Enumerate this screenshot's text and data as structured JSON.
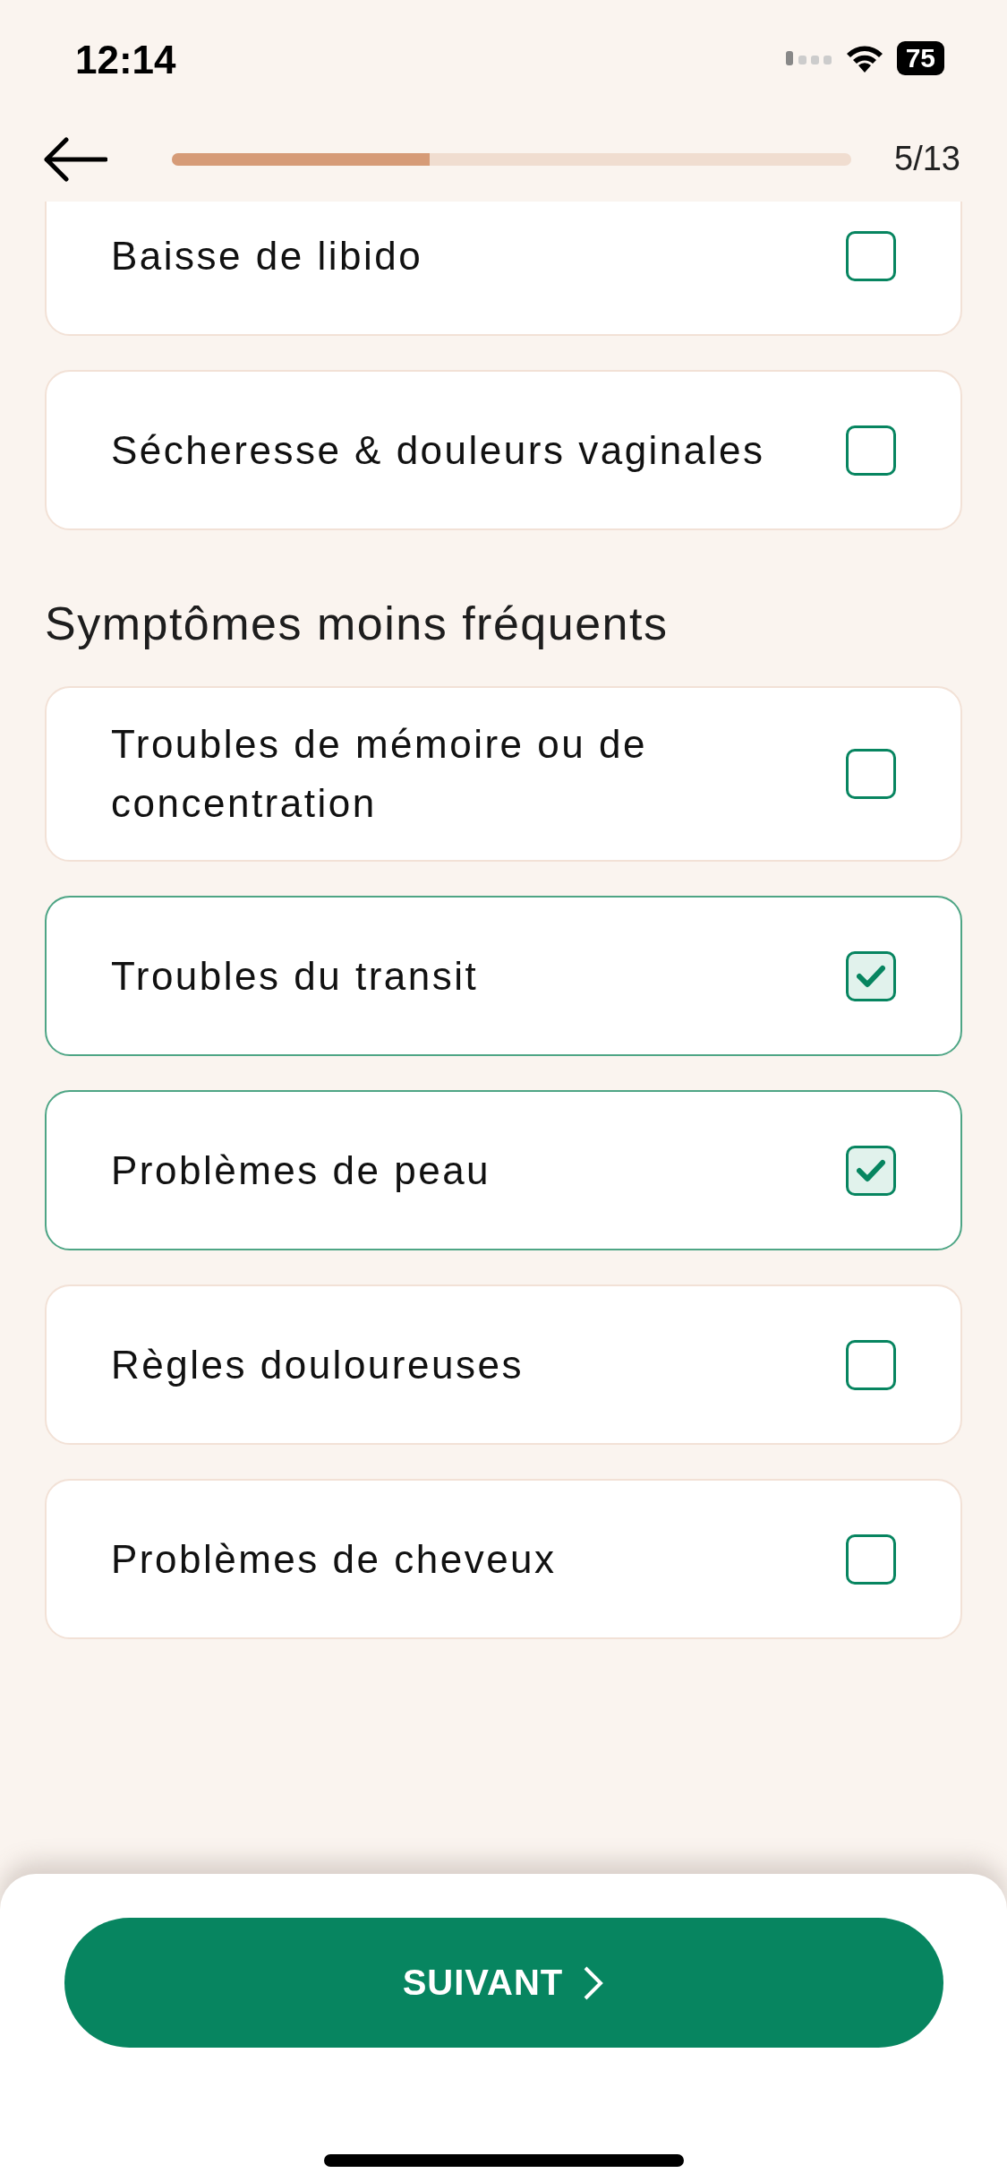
{
  "status_bar": {
    "time": "12:14",
    "battery": "75"
  },
  "header": {
    "progress": {
      "level": 0.38
    },
    "counter": "5/13"
  },
  "sections": [
    {
      "items": [
        {
          "label": "Baisse de libido",
          "checked": false
        },
        {
          "label": "Sécheresse & douleurs vaginales",
          "checked": false
        }
      ]
    },
    {
      "title": "Symptômes moins fréquents",
      "items": [
        {
          "label": "Troubles de mémoire ou de concentration",
          "checked": false
        },
        {
          "label": "Troubles du transit",
          "checked": true
        },
        {
          "label": "Problèmes de peau",
          "checked": true
        },
        {
          "label": "Règles douloureuses",
          "checked": false
        },
        {
          "label": "Problèmes de cheveux",
          "checked": false
        }
      ]
    }
  ],
  "footer": {
    "button": "SUIVANT"
  }
}
